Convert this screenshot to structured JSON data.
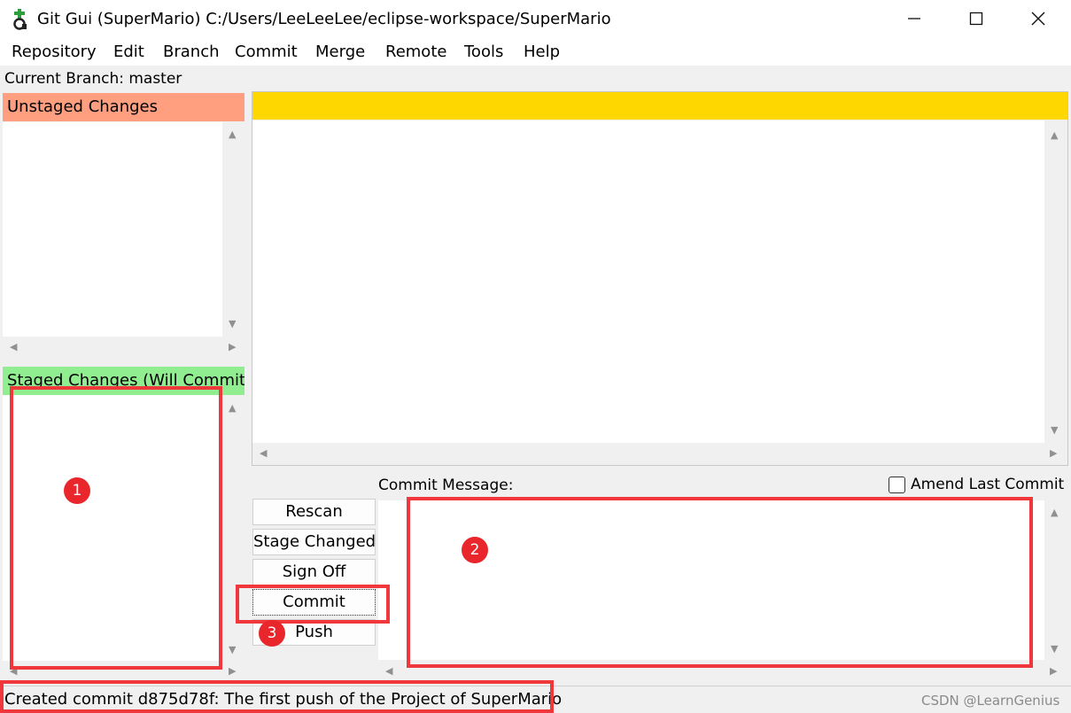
{
  "window": {
    "title": "Git Gui (SuperMario) C:/Users/LeeLeeLee/eclipse-workspace/SuperMario"
  },
  "menu": [
    "Repository",
    "Edit",
    "Branch",
    "Commit",
    "Merge",
    "Remote",
    "Tools",
    "Help"
  ],
  "branch": {
    "text": "Current Branch: master"
  },
  "panes": {
    "unstaged_title": "Unstaged Changes",
    "staged_title": "Staged Changes (Will Commit)"
  },
  "commit_area": {
    "message_label": "Commit Message:",
    "amend_label": "Amend Last Commit",
    "message_value": ""
  },
  "buttons": {
    "rescan": "Rescan",
    "stage_changed": "Stage Changed",
    "sign_off": "Sign Off",
    "commit": "Commit",
    "push": "Push"
  },
  "status": {
    "text": "Created commit d875d78f: The first push of the Project of SuperMario",
    "watermark": "CSDN @LearnGenius"
  },
  "annotations": {
    "badge_1": "1",
    "badge_2": "2",
    "badge_3": "3"
  },
  "colors": {
    "unstaged_header": "#ff9f80",
    "staged_header": "#90ee90",
    "diff_header": "#ffd700",
    "annotation_red": "#f0383c"
  }
}
